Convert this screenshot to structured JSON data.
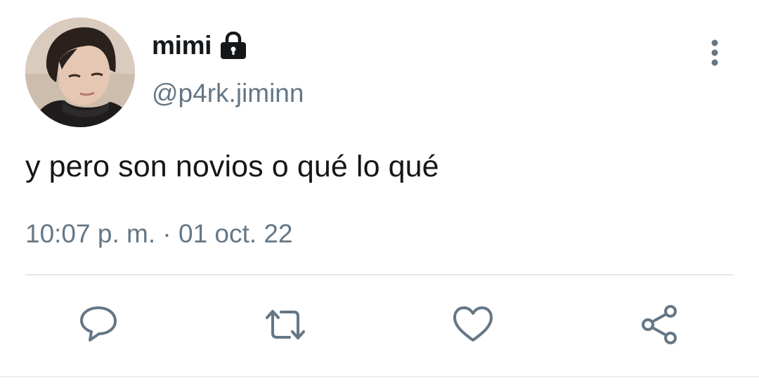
{
  "tweet": {
    "display_name": "mimi",
    "handle": "@p4rk.jiminn",
    "text": "y pero son novios o qué lo qué",
    "time": "10:07 p. m.",
    "separator": "·",
    "date": "01 oct. 22",
    "protected": true
  },
  "icons": {
    "lock": "lock-icon",
    "more": "more-vertical-icon",
    "reply": "reply-icon",
    "retweet": "retweet-icon",
    "like": "heart-icon",
    "share": "share-icon"
  },
  "colors": {
    "text": "#14171a",
    "secondary": "#657786",
    "divider": "#e1e8ed"
  }
}
